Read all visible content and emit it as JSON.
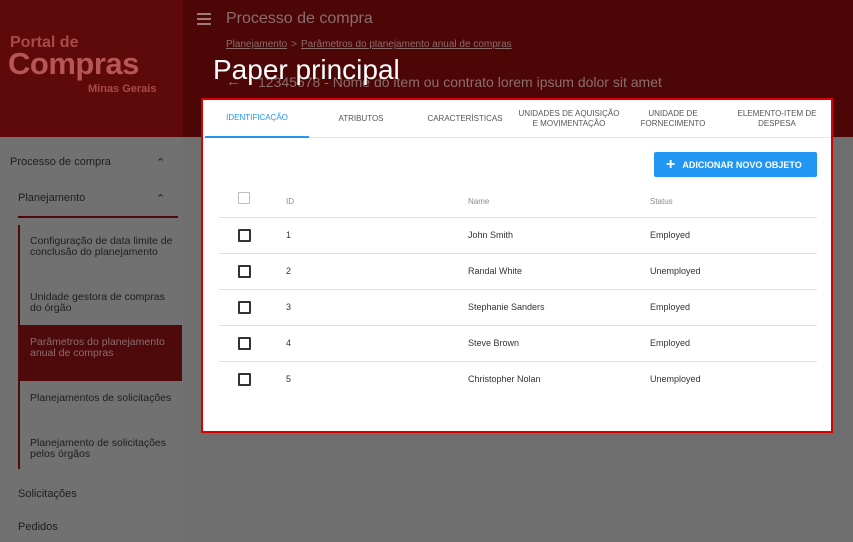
{
  "brand": {
    "line1": "Portal de",
    "line2": "Compras",
    "line3": "Minas Gerais"
  },
  "header": {
    "title": "Processo de compra",
    "breadcrumb": [
      "Planejamento",
      "Parâmetros do planejamento anual de compras"
    ],
    "breadcrumb_sep": ">",
    "back_icon": "←",
    "subtitle": "12345678 - Nome do item ou contrato lorem ipsum dolor sit amet"
  },
  "overlay_label": "Paper principal",
  "sidebar": {
    "section": "Processo de compra",
    "subsection": "Planejamento",
    "sub_items": [
      "Configuração de data limite de conclusão do planejamento",
      "Unidade gestora de compras do órgão",
      "Parâmetros do planejamento anual de compras",
      "Planejamentos de solicitações",
      "Planejamento de solicitações pelos órgãos"
    ],
    "items": [
      "Solicitações",
      "Pedidos"
    ]
  },
  "tabs": [
    "IDENTIFICAÇÃO",
    "ATRIBUTOS",
    "CARACTERÍSTICAS",
    "UNIDADES DE AQUISIÇÃO E MOVIMENTAÇÃO",
    "UNIDADE DE FORNECIMENTO",
    "ELEMENTO-ITEM DE DESPESA"
  ],
  "add_button": {
    "icon": "+",
    "label": "ADICIONAR NOVO OBJETO"
  },
  "table": {
    "columns": [
      "ID",
      "Name",
      "Status"
    ],
    "rows": [
      {
        "id": "1",
        "name": "John Smith",
        "status": "Employed"
      },
      {
        "id": "2",
        "name": "Randal White",
        "status": "Unemployed"
      },
      {
        "id": "3",
        "name": "Stephanie Sanders",
        "status": "Employed"
      },
      {
        "id": "4",
        "name": "Steve Brown",
        "status": "Employed"
      },
      {
        "id": "5",
        "name": "Christopher Nolan",
        "status": "Unemployed"
      }
    ]
  },
  "colors": {
    "primary": "#2196f3",
    "header": "#4c0606",
    "highlight": "#d80000"
  }
}
